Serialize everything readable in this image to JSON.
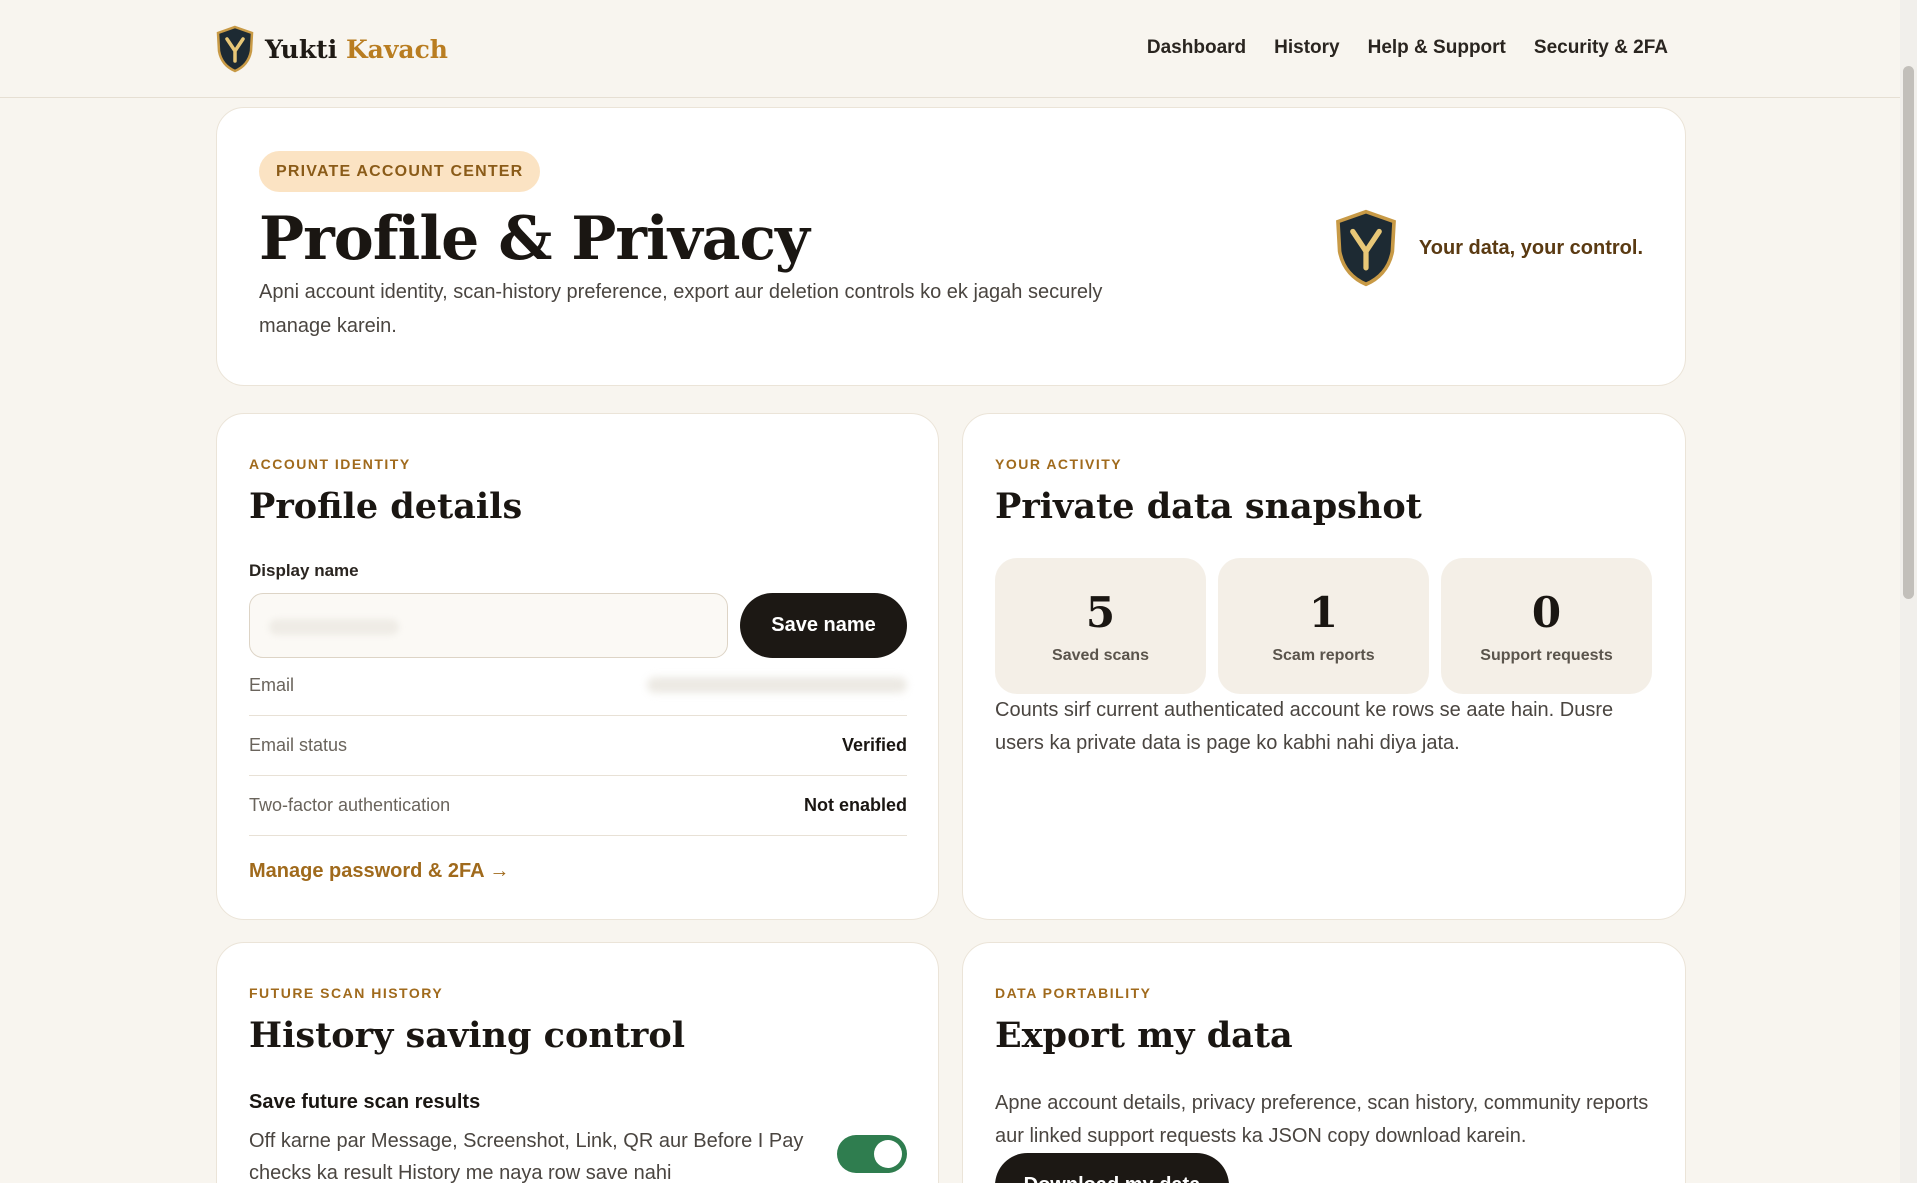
{
  "brand": {
    "name_part1": "Yukti",
    "name_part2": "Kavach"
  },
  "nav": [
    "Dashboard",
    "History",
    "Help & Support",
    "Security & 2FA"
  ],
  "hero": {
    "pill": "PRIVATE ACCOUNT CENTER",
    "title": "Profile & Privacy",
    "description": "Apni account identity, scan-history preference, export aur deletion controls ko ek jagah securely manage karein.",
    "tagline": "Your data, your control."
  },
  "profile": {
    "eyebrow": "ACCOUNT IDENTITY",
    "title": "Profile details",
    "display_name_label": "Display name",
    "display_name_value": "",
    "save_label": "Save name",
    "rows": [
      {
        "label": "Email",
        "value": ""
      },
      {
        "label": "Email status",
        "value": "Verified"
      },
      {
        "label": "Two-factor authentication",
        "value": "Not enabled"
      }
    ],
    "manage_link": "Manage password & 2FA →"
  },
  "activity": {
    "eyebrow": "YOUR ACTIVITY",
    "title": "Private data snapshot",
    "stats": [
      {
        "value": "5",
        "label": "Saved scans"
      },
      {
        "value": "1",
        "label": "Scam reports"
      },
      {
        "value": "0",
        "label": "Support requests"
      }
    ],
    "note": "Counts sirf current authenticated account ke rows se aate hain. Dusre users ka private data is page ko kabhi nahi diya jata."
  },
  "history": {
    "eyebrow": "FUTURE SCAN HISTORY",
    "title": "History saving control",
    "subhead": "Save future scan results",
    "description": "Off karne par Message, Screenshot, Link, QR aur Before I Pay checks ka result History me naya row save nahi",
    "toggle_on": true
  },
  "export": {
    "eyebrow": "DATA PORTABILITY",
    "title": "Export my data",
    "description": "Apne account details, privacy preference, scan history, community reports aur linked support requests ka JSON copy download karein.",
    "button": "Download my data"
  },
  "colors": {
    "accent": "#a06a1c",
    "dark": "#1c1814",
    "toggle": "#2f7d4f",
    "background": "#f8f5ef"
  }
}
